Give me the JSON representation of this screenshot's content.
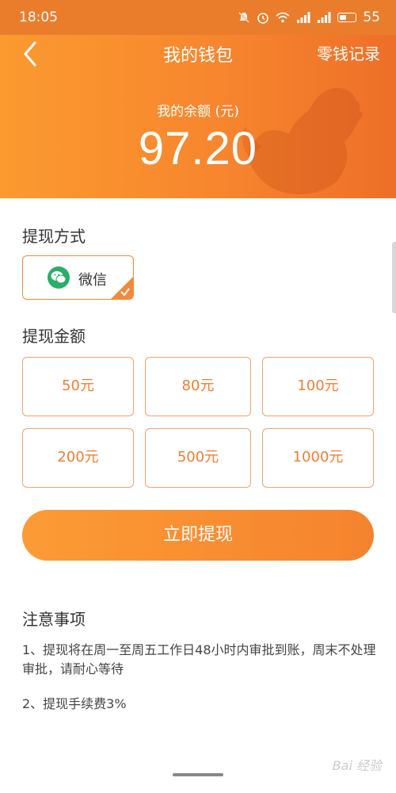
{
  "status_bar": {
    "time": "18:05",
    "icons": [
      "mute-icon",
      "alarm-icon",
      "wifi-icon",
      "signal-icon",
      "signal-4g-icon",
      "battery-icon"
    ],
    "battery_level": "55"
  },
  "header": {
    "back_icon": "chevron-left-icon",
    "title": "我的钱包",
    "records_link": "零钱记录",
    "balance_label": "我的余额 (元)",
    "balance_value": "97.20",
    "background_colors": [
      "#fb9a2f",
      "#ee6f28"
    ]
  },
  "withdraw_method": {
    "label": "提现方式",
    "option": {
      "icon": "wechat-icon",
      "label": "微信",
      "selected": true
    }
  },
  "withdraw_amount": {
    "label": "提现金额",
    "options": [
      "50元",
      "80元",
      "100元",
      "200元",
      "500元",
      "1000元"
    ]
  },
  "submit_button": {
    "label": "立即提现"
  },
  "notes": {
    "title": "注意事项",
    "items": [
      "1、提现将在周一至周五工作日48小时内审批到账，周末不处理审批，请耐心等待",
      "2、提现手续费3%"
    ]
  },
  "watermark": {
    "text": "Bai 经验"
  },
  "accent_color": "#f08a3c"
}
